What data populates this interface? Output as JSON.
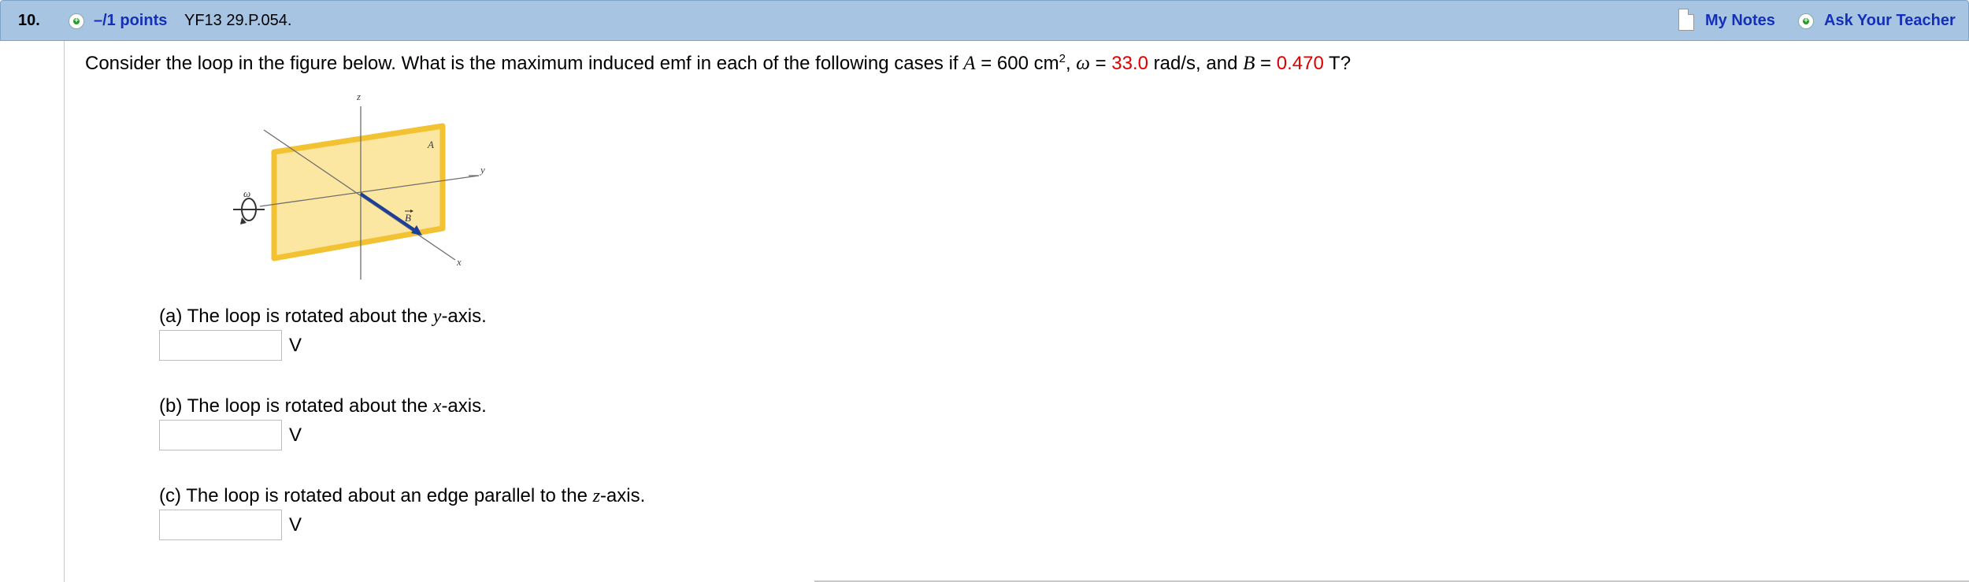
{
  "header": {
    "question_number": "10.",
    "points": "–/1 points",
    "question_id": "YF13 29.P.054.",
    "my_notes": "My Notes",
    "ask_teacher": "Ask Your Teacher"
  },
  "question": {
    "intro": "Consider the loop in the figure below. What is the maximum induced emf in each of the following cases if ",
    "A_symbol": "A",
    "A_eq": " = 600 cm",
    "A_exp": "2",
    "sep1": ", ",
    "omega_symbol": "ω",
    "omega_eq": " = ",
    "omega_value": "33.0",
    "omega_unit": " rad/s, and ",
    "B_symbol": "B",
    "B_eq": " = ",
    "B_value": "0.470",
    "B_unit": " T?"
  },
  "figure": {
    "z_label": "z",
    "y_label": "y",
    "x_label": "x",
    "A_label": "A",
    "B_label": "B",
    "omega_label": "ω"
  },
  "parts": [
    {
      "prefix": "(a) The loop is rotated about the ",
      "axis": "y",
      "suffix": "-axis.",
      "unit": "V",
      "value": ""
    },
    {
      "prefix": "(b) The loop is rotated about the ",
      "axis": "x",
      "suffix": "-axis.",
      "unit": "V",
      "value": ""
    },
    {
      "prefix": "(c) The loop is rotated about an edge parallel to the ",
      "axis": "z",
      "suffix": "-axis.",
      "unit": "V",
      "value": ""
    }
  ],
  "colors": {
    "header_bg": "#a7c5e2",
    "link": "#1530b8",
    "given_value": "#dd0000",
    "loop_fill": "#fbe6a2",
    "loop_border": "#f2c233",
    "vector": "#1b3f9a"
  }
}
